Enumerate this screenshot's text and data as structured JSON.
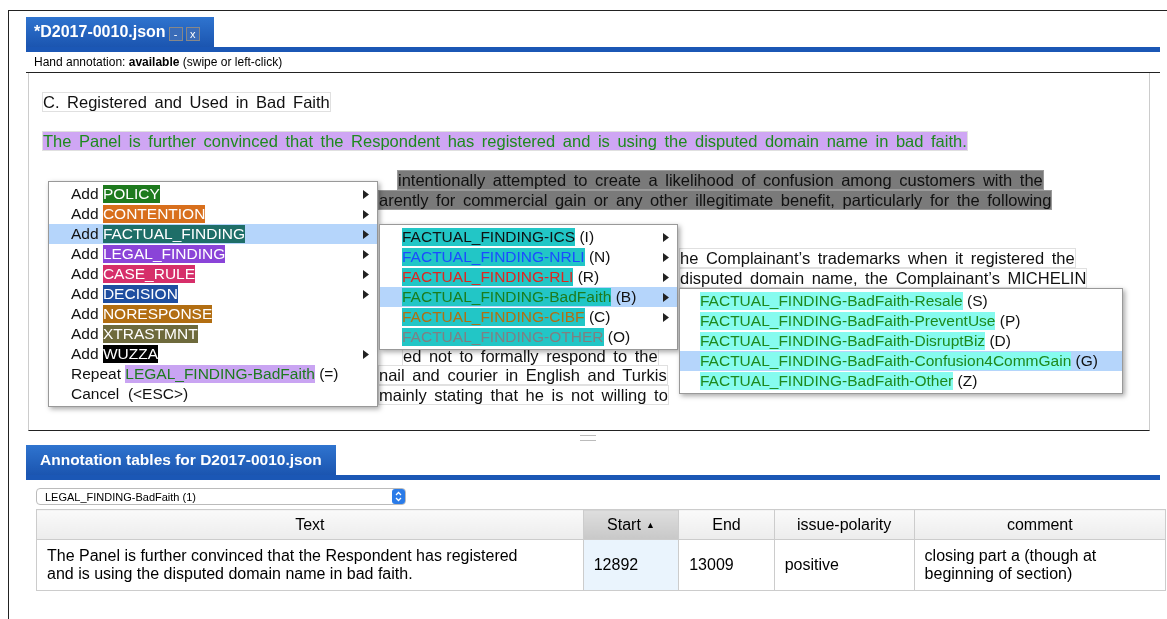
{
  "editor_tab": {
    "title": "*D2017-0010.json",
    "buttons": [
      "-",
      "x"
    ]
  },
  "info_line": "Hand annotation: **available** (swipe or left-click)",
  "document": [
    {
      "kind": "heading",
      "lines": [
        {
          "kind": "full",
          "text": "C. Registered and Used in Bad Faith"
        }
      ]
    },
    {
      "kind": "annotated",
      "lines": [
        {
          "kind": "full",
          "text": "The Panel is further convinced that the Respondent has registered and is using the disputed domain name in bad faith."
        }
      ]
    },
    {
      "kind": "selected",
      "lines": [
        {
          "kind": "beside_menu_first",
          "text": "intentionally attempted to create a likelihood of confusion among customers with the"
        },
        {
          "kind": "beside_menu",
          "text": "arently for commercial gain or any other illegitimate benefit, particularly for the following"
        },
        {
          "kind": "covered"
        }
      ]
    },
    {
      "kind": "plain",
      "lines": [
        {
          "kind": "beside_submenu",
          "text": "he Complainant’s trademarks when it registered the"
        },
        {
          "kind": "beside_submenu",
          "text": "disputed domain name, the Complainant’s MICHELIN"
        },
        {
          "kind": "covered"
        }
      ]
    },
    {
      "kind": "plain",
      "lines": [
        {
          "kind": "covered"
        },
        {
          "kind": "beside_menu_far",
          "text": "ed not to formally respond to the"
        },
        {
          "kind": "beside_menu",
          "text": "nail and courier in English and Turkis"
        },
        {
          "kind": "beside_menu",
          "text": "mainly stating that he is not willing to"
        }
      ]
    }
  ],
  "context_menu": [
    {
      "kind": "add",
      "prefix": "Add",
      "label": "POLICY",
      "color": "#1e7a1e",
      "has_submenu": true,
      "selected": false
    },
    {
      "kind": "add",
      "prefix": "Add",
      "label": "CONTENTION",
      "color": "#d86f1c",
      "has_submenu": true,
      "selected": false
    },
    {
      "kind": "add",
      "prefix": "Add",
      "label": "FACTUAL_FINDING",
      "color": "#1e6e68",
      "has_submenu": true,
      "selected": true
    },
    {
      "kind": "add",
      "prefix": "Add",
      "label": "LEGAL_FINDING",
      "color": "#8a44d8",
      "has_submenu": true,
      "selected": false
    },
    {
      "kind": "add",
      "prefix": "Add",
      "label": "CASE_RULE",
      "color": "#d62f6a",
      "has_submenu": true,
      "selected": false
    },
    {
      "kind": "add",
      "prefix": "Add",
      "label": "DECISION",
      "color": "#1f4ea0",
      "has_submenu": true,
      "selected": false
    },
    {
      "kind": "add",
      "prefix": "Add",
      "label": "NORESPONSE",
      "color": "#b26e12",
      "has_submenu": false,
      "selected": false
    },
    {
      "kind": "add",
      "prefix": "Add",
      "label": "XTRASTMNT",
      "color": "#6e6a3c",
      "has_submenu": false,
      "selected": false
    },
    {
      "kind": "add",
      "prefix": "Add",
      "label": "WUZZA",
      "color": "#000000",
      "has_submenu": true,
      "selected": false
    },
    {
      "kind": "repeat",
      "prefix": "Repeat",
      "label": "LEGAL_FINDING-BadFaith",
      "suffix": "(=)",
      "color": "#c9a4f2",
      "has_submenu": false,
      "selected": false
    },
    {
      "kind": "cancel",
      "prefix": "Cancel",
      "suffix": "(<ESC>)",
      "has_submenu": false,
      "selected": false
    }
  ],
  "submenu": [
    {
      "label": "FACTUAL_FINDING-ICS",
      "suffix": "(I)",
      "kind": "black",
      "has_submenu": true,
      "selected": false
    },
    {
      "label": "FACTUAL_FINDING-NRLI",
      "suffix": "(N)",
      "kind": "blue",
      "has_submenu": true,
      "selected": false
    },
    {
      "label": "FACTUAL_FINDING-RLI",
      "suffix": "(R)",
      "kind": "red",
      "has_submenu": true,
      "selected": false
    },
    {
      "label": "FACTUAL_FINDING-BadFaith",
      "suffix": "(B)",
      "kind": "green",
      "has_submenu": true,
      "selected": true
    },
    {
      "label": "FACTUAL_FINDING-CIBF",
      "suffix": "(C)",
      "kind": "brown",
      "has_submenu": true,
      "selected": false
    },
    {
      "label": "FACTUAL_FINDING-OTHER",
      "suffix": "(O)",
      "kind": "gray",
      "has_submenu": false,
      "selected": false
    }
  ],
  "subsubmenu": [
    {
      "label": "FACTUAL_FINDING-BadFaith-Resale",
      "suffix": "(S)",
      "has_submenu": false,
      "selected": false
    },
    {
      "label": "FACTUAL_FINDING-BadFaith-PreventUse",
      "suffix": "(P)",
      "has_submenu": false,
      "selected": false
    },
    {
      "label": "FACTUAL_FINDING-BadFaith-DisruptBiz",
      "suffix": "(D)",
      "has_submenu": false,
      "selected": false
    },
    {
      "label": "FACTUAL_FINDING-BadFaith-Confusion4CommGain",
      "suffix": "(G)",
      "has_submenu": false,
      "selected": true
    },
    {
      "label": "FACTUAL_FINDING-BadFaith-Other",
      "suffix": "(Z)",
      "has_submenu": false,
      "selected": false
    }
  ],
  "tables_tab": {
    "title": "Annotation tables for D2017-0010.json"
  },
  "type_select": {
    "value": "LEGAL_FINDING-BadFaith (1)"
  },
  "table": {
    "columns": [
      {
        "label": "Text",
        "sorted": false
      },
      {
        "label": "Start",
        "sorted": true,
        "sort_arrow": "▲"
      },
      {
        "label": "End",
        "sorted": false
      },
      {
        "label": "issue-polarity",
        "sorted": false
      },
      {
        "label": "comment",
        "sorted": false
      }
    ],
    "rows": [
      [
        "The Panel is further convinced that the Respondent has registered and is using the disputed domain name in bad faith.",
        "12892",
        "13009",
        "positive",
        "closing part a (though at beginning of section)"
      ]
    ]
  }
}
